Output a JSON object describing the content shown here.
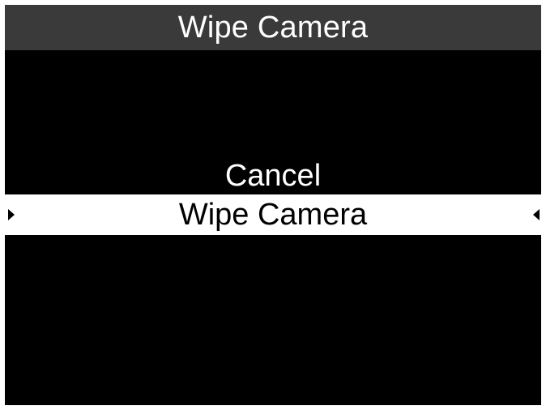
{
  "header": {
    "title": "Wipe Camera"
  },
  "menu": {
    "items": [
      {
        "label": "Cancel",
        "selected": false
      },
      {
        "label": "Wipe Camera",
        "selected": true
      }
    ]
  },
  "icons": {
    "left_selector": "caret-right-icon",
    "right_selector": "caret-left-icon"
  },
  "colors": {
    "title_bar": "#3a3a3a",
    "background": "#000000",
    "selection": "#ffffff",
    "text": "#ffffff",
    "selected_text": "#000000"
  }
}
